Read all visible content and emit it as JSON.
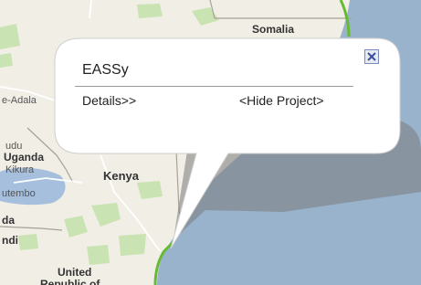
{
  "map": {
    "places": [
      {
        "id": "somalia",
        "label": "Somalia"
      },
      {
        "id": "adala",
        "label": "e-Adala"
      },
      {
        "id": "gudu",
        "label": "udu"
      },
      {
        "id": "uganda",
        "label": "Uganda"
      },
      {
        "id": "kikura",
        "label": "Kikura"
      },
      {
        "id": "kenya",
        "label": "Kenya"
      },
      {
        "id": "utembo",
        "label": "utembo"
      },
      {
        "id": "da",
        "label": "da"
      },
      {
        "id": "ndi",
        "label": "ndi"
      },
      {
        "id": "united",
        "label": "United"
      },
      {
        "id": "republic",
        "label": "Republic of"
      }
    ],
    "colors": {
      "land": "#f1eee6",
      "sea": "#99b3cc",
      "lake": "#a5bfdd",
      "park": "#cae3b2",
      "cable": "#66bb33"
    }
  },
  "popup": {
    "title": "EASSy",
    "details_link": "Details>>",
    "hide_link": "<Hide Project>",
    "close_icon": "close-x-icon"
  }
}
